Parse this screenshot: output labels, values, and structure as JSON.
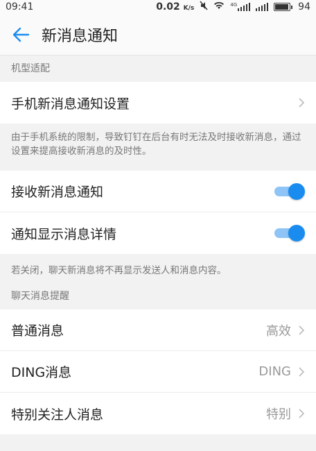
{
  "status_bar": {
    "time": "09:41",
    "speed": "0.02",
    "speed_unit": "K/s",
    "network_label": "4G",
    "battery": "94",
    "battery_level": 0.94
  },
  "app_bar": {
    "title": "新消息通知"
  },
  "section_device": {
    "header": "机型适配",
    "phone_settings_label": "手机新消息通知设置",
    "note": "由于手机系统的限制，导致钉钉在后台有时无法及时接收新消息，通过设置来提高接收新消息的及时性。"
  },
  "section_notify": {
    "receive_label": "接收新消息通知",
    "receive_on": true,
    "detail_label": "通知显示消息详情",
    "detail_on": true,
    "note": "若关闭，聊天新消息将不再显示发送人和消息内容。"
  },
  "section_chat": {
    "header": "聊天消息提醒",
    "items": [
      {
        "label": "普通消息",
        "value": "高效"
      },
      {
        "label": "DING消息",
        "value": "DING"
      },
      {
        "label": "特别关注人消息",
        "value": "特别"
      }
    ]
  },
  "colors": {
    "accent": "#1a8cf0",
    "toggle_track": "#8ec4f6"
  }
}
